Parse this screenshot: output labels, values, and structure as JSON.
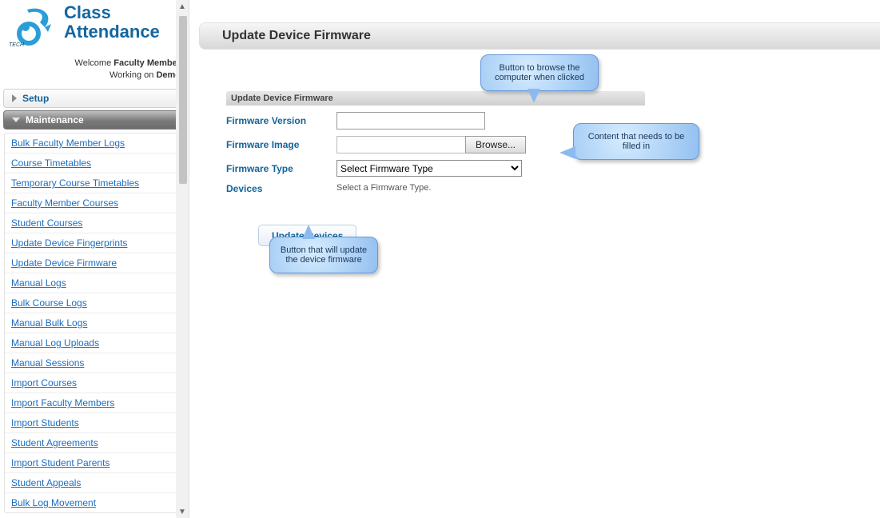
{
  "brand": {
    "line1": "Class",
    "line2": "Attendance"
  },
  "welcome": {
    "prefix": "Welcome ",
    "role": "Faculty Member",
    "workingPrefix": "Working on ",
    "context": "Demo"
  },
  "sections": {
    "setup": "Setup",
    "maintenance": "Maintenance"
  },
  "menu": [
    "Bulk Faculty Member Logs",
    "Course Timetables",
    "Temporary Course Timetables",
    "Faculty Member Courses",
    "Student Courses",
    "Update Device Fingerprints",
    "Update Device Firmware",
    "Manual Logs",
    "Bulk Course Logs",
    "Manual Bulk Logs",
    "Manual Log Uploads",
    "Manual Sessions",
    "Import Courses",
    "Import Faculty Members",
    "Import Students",
    "Student Agreements",
    "Import Student Parents",
    "Student Appeals",
    "Bulk Log Movement"
  ],
  "page": {
    "title": "Update Device Firmware",
    "sectionTitle": "Update Device Firmware",
    "labels": {
      "firmwareVersion": "Firmware Version",
      "firmwareImage": "Firmware Image",
      "firmwareType": "Firmware Type",
      "devices": "Devices"
    },
    "browseButton": "Browse...",
    "firmwareTypePlaceholder": "Select Firmware Type",
    "devicesHint": "Select a Firmware Type.",
    "updateButton": "Update Devices"
  },
  "callouts": {
    "browse": "Button to browse the computer when clicked",
    "content": "Content that needs to be filled in",
    "update": "Button that will update the device firmware"
  }
}
